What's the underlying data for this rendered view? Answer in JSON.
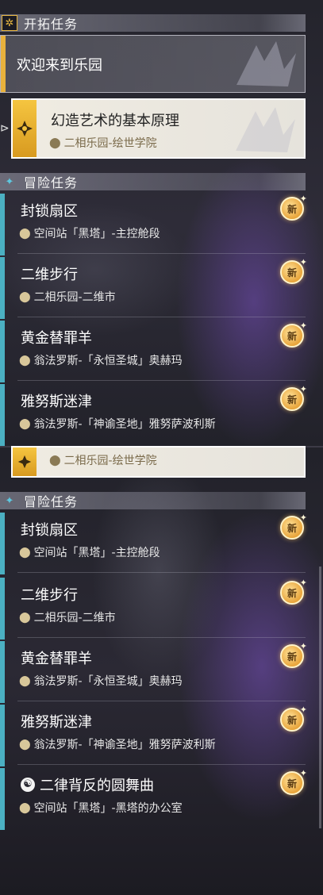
{
  "panel1": {
    "trailblaze": {
      "header": "开拓任务",
      "card1": {
        "title": "欢迎来到乐园"
      },
      "card2": {
        "title": "幻造艺术的基本原理",
        "location": "二相乐园-绘世学院"
      }
    },
    "adventure": {
      "header": "冒险任务",
      "items": [
        {
          "title": "封锁扇区",
          "location": "空间站「黑塔」-主控舱段",
          "badge": "新"
        },
        {
          "title": "二维步行",
          "location": "二相乐园-二维市",
          "badge": "新"
        },
        {
          "title": "黄金替罪羊",
          "location": "翁法罗斯-「永恒圣城」奥赫玛",
          "badge": "新"
        },
        {
          "title": "雅努斯迷津",
          "location": "翁法罗斯-「神谕圣地」雅努萨波利斯",
          "badge": "新"
        }
      ]
    }
  },
  "panel2": {
    "partial_card": {
      "location": "二相乐园-绘世学院"
    },
    "adventure": {
      "header": "冒险任务",
      "items": [
        {
          "title": "封锁扇区",
          "location": "空间站「黑塔」-主控舱段",
          "badge": "新"
        },
        {
          "title": "二维步行",
          "location": "二相乐园-二维市",
          "badge": "新"
        },
        {
          "title": "黄金替罪羊",
          "location": "翁法罗斯-「永恒圣城」奥赫玛",
          "badge": "新"
        },
        {
          "title": "雅努斯迷津",
          "location": "翁法罗斯-「神谕圣地」雅努萨波利斯",
          "badge": "新"
        },
        {
          "title": "二律背反的圆舞曲",
          "location": "空间站「黑塔」-黑塔的办公室",
          "badge": "新",
          "icon": "swirl-icon"
        }
      ]
    }
  },
  "colors": {
    "trailblaze_accent": "#e8b13c",
    "adventure_accent": "#4bb0c2",
    "new_badge": "#e8a43a"
  }
}
